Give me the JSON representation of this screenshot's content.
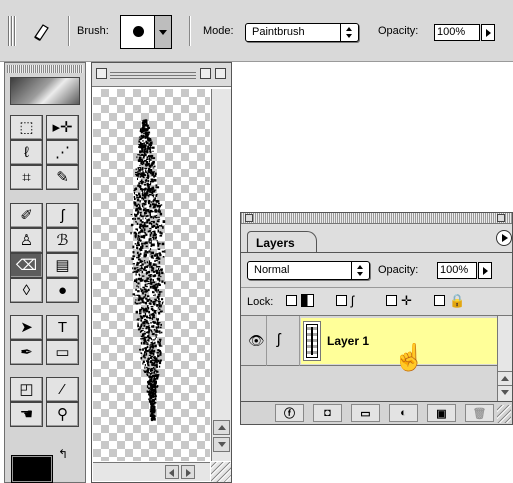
{
  "options_bar": {
    "brush_label": "Brush:",
    "mode_label": "Mode:",
    "mode_value": "Paintbrush",
    "opacity_label": "Opacity:",
    "opacity_value": "100%",
    "tool_icon": "eraser-icon"
  },
  "toolbox": {
    "tools": [
      {
        "name": "marquee-tool",
        "glyph": "⬚"
      },
      {
        "name": "move-tool",
        "glyph": "▸✛"
      },
      {
        "name": "lasso-tool",
        "glyph": "ℓ"
      },
      {
        "name": "magic-wand-tool",
        "glyph": "⋰"
      },
      {
        "name": "crop-tool",
        "glyph": "⌗"
      },
      {
        "name": "slice-tool",
        "glyph": "✎"
      },
      {
        "name": "healing-brush-tool",
        "glyph": "✐"
      },
      {
        "name": "brush-tool",
        "glyph": "ʃ"
      },
      {
        "name": "clone-stamp-tool",
        "glyph": "♙"
      },
      {
        "name": "history-brush-tool",
        "glyph": "ℬ"
      },
      {
        "name": "eraser-tool",
        "glyph": "⌫",
        "selected": true
      },
      {
        "name": "gradient-tool",
        "glyph": "▤"
      },
      {
        "name": "blur-tool",
        "glyph": "◊"
      },
      {
        "name": "dodge-tool",
        "glyph": "●"
      },
      {
        "name": "path-selection-tool",
        "glyph": "➤"
      },
      {
        "name": "type-tool",
        "glyph": "T"
      },
      {
        "name": "pen-tool",
        "glyph": "✒"
      },
      {
        "name": "shape-tool",
        "glyph": "▭"
      },
      {
        "name": "notes-tool",
        "glyph": "◰"
      },
      {
        "name": "eyedropper-tool",
        "glyph": "⁄"
      },
      {
        "name": "hand-tool",
        "glyph": "☚"
      },
      {
        "name": "zoom-tool",
        "glyph": "⚲"
      }
    ],
    "foreground_color": "#000000",
    "background_color": "#ffffff"
  },
  "document": {
    "canvas_pattern": "transparency-checkerboard",
    "stroke_color": "#000000"
  },
  "layers_palette": {
    "tab_label": "Layers",
    "blend_mode": "Normal",
    "opacity_label": "Opacity:",
    "opacity_value": "100%",
    "lock_label": "Lock:",
    "layers": [
      {
        "name": "Layer 1",
        "visible": true,
        "selected": true,
        "highlight_color": "#ffff99"
      }
    ],
    "bottom_buttons": [
      {
        "name": "layer-style-button",
        "glyph": "ⓕ"
      },
      {
        "name": "add-mask-button",
        "glyph": "◘"
      },
      {
        "name": "new-set-button",
        "glyph": "▭"
      },
      {
        "name": "adjustment-layer-button",
        "glyph": "◐"
      },
      {
        "name": "new-layer-button",
        "glyph": "▣"
      },
      {
        "name": "delete-layer-button",
        "glyph": "🗑",
        "disabled": true
      }
    ]
  }
}
